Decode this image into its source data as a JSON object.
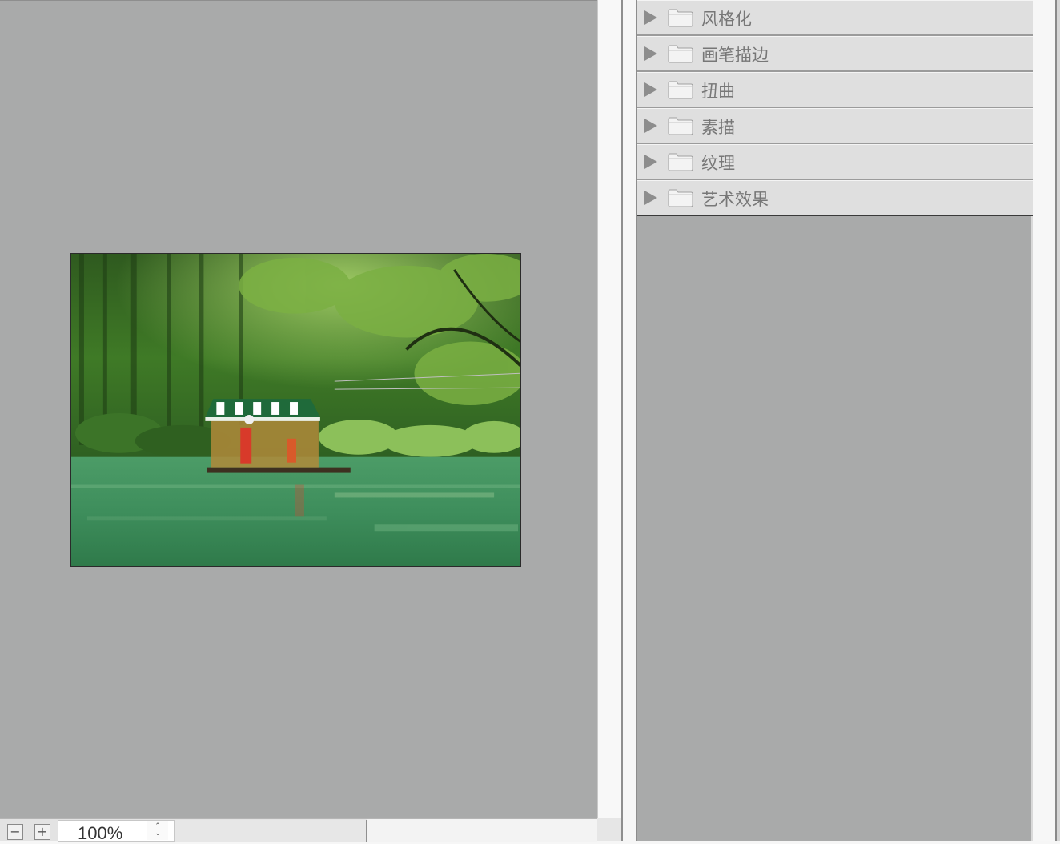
{
  "preview": {
    "zoom_value": "100%",
    "zoom_out_symbol": "−",
    "zoom_in_symbol": "+",
    "stepper_up": "⌃",
    "stepper_down": "⌄"
  },
  "filter_folders": [
    {
      "label": "风格化",
      "icon": "folder-icon"
    },
    {
      "label": "画笔描边",
      "icon": "folder-icon"
    },
    {
      "label": "扭曲",
      "icon": "folder-icon"
    },
    {
      "label": "素描",
      "icon": "folder-icon"
    },
    {
      "label": "纹理",
      "icon": "folder-icon"
    },
    {
      "label": "艺术效果",
      "icon": "folder-icon"
    }
  ],
  "colors": {
    "panel_background": "#a9aaaa",
    "folder_row": "#dfdfdf",
    "label_text": "#777777"
  }
}
